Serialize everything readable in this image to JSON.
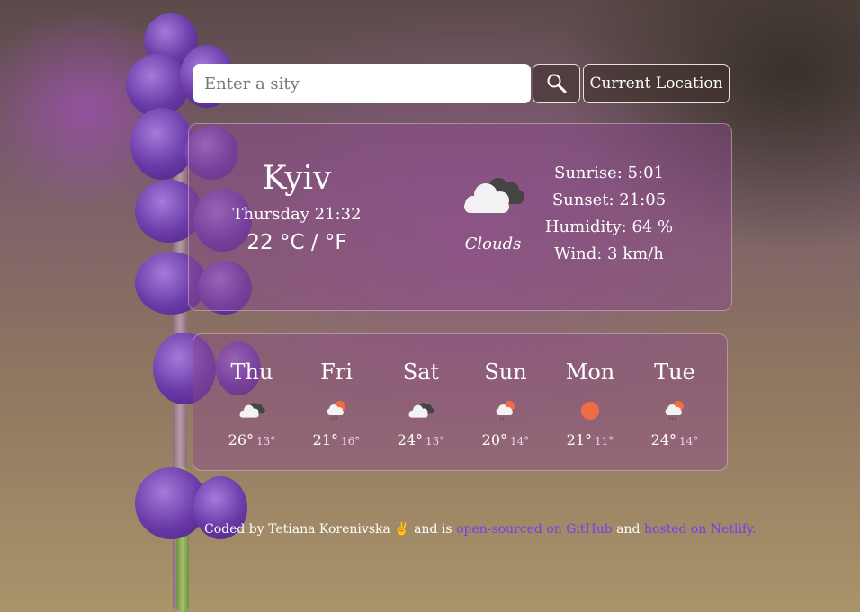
{
  "search": {
    "placeholder": "Enter a sity",
    "value": "",
    "search_icon": "magnifier-icon",
    "current_location_label": "Current Location"
  },
  "current": {
    "city": "Kyiv",
    "datetime": "Thursday 21:32",
    "temperature": "22",
    "unit_c": "°C",
    "unit_separator": "/",
    "unit_f": "°F",
    "condition_icon": "clouds-icon",
    "condition": "Clouds",
    "details": {
      "sunrise": "Sunrise: 5:01",
      "sunset": "Sunset: 21:05",
      "humidity": "Humidity: 64 %",
      "wind": "Wind: 3 km/h"
    }
  },
  "forecast": [
    {
      "day": "Thu",
      "icon": "clouds-icon",
      "max": "26°",
      "min": "13°"
    },
    {
      "day": "Fri",
      "icon": "rain-sun-icon",
      "max": "21°",
      "min": "16°"
    },
    {
      "day": "Sat",
      "icon": "clouds-icon",
      "max": "24°",
      "min": "13°"
    },
    {
      "day": "Sun",
      "icon": "rain-sun-icon",
      "max": "20°",
      "min": "14°"
    },
    {
      "day": "Mon",
      "icon": "sun-icon",
      "max": "21°",
      "min": "11°"
    },
    {
      "day": "Tue",
      "icon": "rain-sun-icon",
      "max": "24°",
      "min": "14°"
    }
  ],
  "footer": {
    "prefix": "Coded by Tetiana Korenivska ✌ and is ",
    "github_link": "open-sourced on GitHub",
    "middle": " and ",
    "netlify_link": "hosted on Netlify."
  },
  "colors": {
    "link": "#7a3cf0",
    "sun": "#ef6c45",
    "cloud_light": "#f2f2f2",
    "cloud_dark": "#444444"
  }
}
